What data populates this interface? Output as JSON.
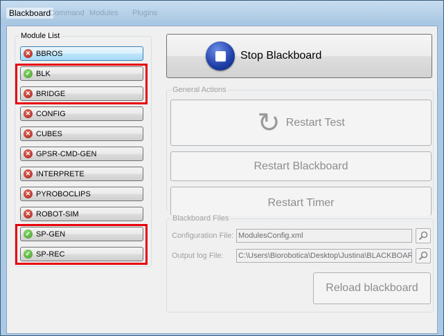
{
  "window": {
    "title": "Blackboard"
  },
  "menubar_ghost": [
    "Command",
    "Modules",
    "Plugins"
  ],
  "module_list": {
    "legend": "Module List",
    "modules": [
      {
        "label": "BBROS",
        "status": "error"
      },
      {
        "label": "BLK",
        "status": "ok"
      },
      {
        "label": "BRIDGE",
        "status": "error"
      },
      {
        "label": "CONFIG",
        "status": "error"
      },
      {
        "label": "CUBES",
        "status": "error"
      },
      {
        "label": "GPSR-CMD-GEN",
        "status": "error"
      },
      {
        "label": "INTERPRETE",
        "status": "error"
      },
      {
        "label": "PYROBOCLIPS",
        "status": "error"
      },
      {
        "label": "ROBOT-SIM",
        "status": "error"
      },
      {
        "label": "SP-GEN",
        "status": "ok"
      },
      {
        "label": "SP-REC",
        "status": "ok"
      }
    ]
  },
  "stop_button": {
    "label": "Stop Blackboard"
  },
  "general_actions": {
    "legend": "General Actions",
    "restart_test": "Restart Test",
    "restart_blackboard": "Restart Blackboard",
    "restart_timer": "Restart Timer"
  },
  "blackboard_files": {
    "legend": "Blackboard Files",
    "config_label": "Configuration File:",
    "config_value": "ModulesConfig.xml",
    "log_label": "Output log File:",
    "log_value": "C:\\Users\\Biorobotica\\Desktop\\Justina\\BLACKBOARD",
    "reload_label": "Reload blackboard"
  },
  "colors": {
    "highlight": "#e8000b",
    "status_error": "#b3271d",
    "status_ok": "#4caf2f",
    "stop_icon": "#1f3fa8"
  }
}
